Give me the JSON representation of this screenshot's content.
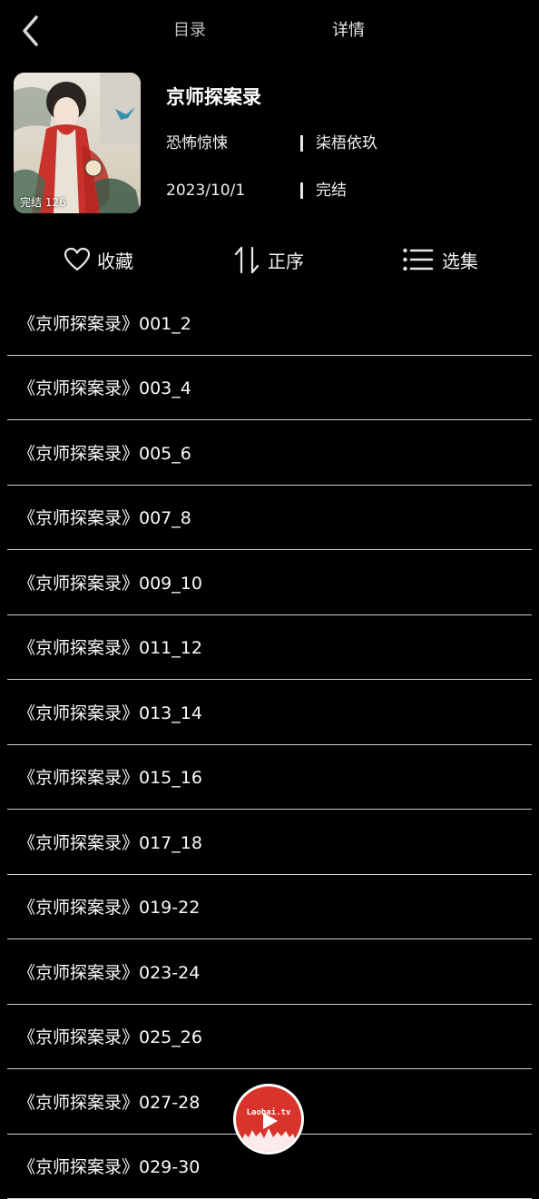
{
  "header": {
    "back_icon": "chevron-left-icon",
    "tabs": [
      {
        "label": "目录"
      },
      {
        "label": "详情"
      }
    ]
  },
  "book": {
    "title": "京师探案录",
    "cover_badge": "完结 126",
    "genre": "恐怖惊悚",
    "author": "柒梧依玖",
    "date": "2023/10/1",
    "status": "完结"
  },
  "actions": {
    "favorite": {
      "label": "收藏",
      "icon": "heart-icon"
    },
    "sort": {
      "label": "正序",
      "icon": "sort-icon"
    },
    "select": {
      "label": "选集",
      "icon": "list-icon"
    }
  },
  "episodes": [
    "《京师探案录》001_2",
    "《京师探案录》003_4",
    "《京师探案录》005_6",
    "《京师探案录》007_8",
    "《京师探案录》009_10",
    "《京师探案录》011_12",
    "《京师探案录》013_14",
    "《京师探案录》015_16",
    "《京师探案录》017_18",
    "《京师探案录》019-22",
    "《京师探案录》023-24",
    "《京师探案录》025_26",
    "《京师探案录》027-28",
    "《京师探案录》029-30"
  ],
  "floating_button": {
    "brand": "Laobai.tv",
    "icon": "play-icon",
    "color": "#d9342b"
  }
}
